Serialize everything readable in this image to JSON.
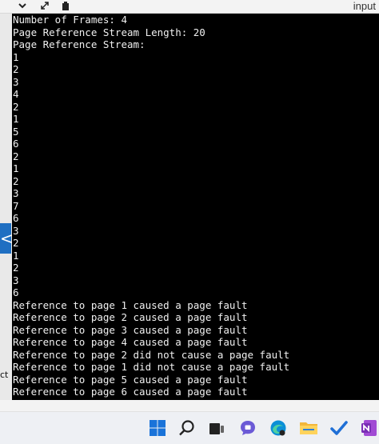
{
  "topbar": {
    "input_label": "input",
    "icons": [
      "chevron-down-icon",
      "expand-icon",
      "clipboard-icon"
    ]
  },
  "left_strip": {
    "nav_glyph": "<",
    "partial_text": "ct"
  },
  "console": {
    "lines": [
      "Number of Frames: 4",
      "Page Reference Stream Length: 20",
      "Page Reference Stream:",
      "1",
      "2",
      "3",
      "4",
      "2",
      "1",
      "5",
      "6",
      "2",
      "1",
      "2",
      "3",
      "7",
      "6",
      "3",
      "2",
      "1",
      "2",
      "3",
      "6",
      "Reference to page 1 caused a page fault",
      "Reference to page 2 caused a page fault",
      "Reference to page 3 caused a page fault",
      "Reference to page 4 caused a page fault",
      "Reference to page 2 did not cause a page fault",
      "Reference to page 1 did not cause a page fault",
      "Reference to page 5 caused a page fault",
      "Reference to page 6 caused a page fault"
    ]
  },
  "taskbar": {
    "icons": [
      "windows-start-icon",
      "search-icon",
      "task-view-icon",
      "chat-icon",
      "edge-browser-icon",
      "file-explorer-icon",
      "todo-icon",
      "onenote-icon"
    ],
    "colors": {
      "accent": "#1f6fc2",
      "background": "#eef0f4"
    }
  }
}
